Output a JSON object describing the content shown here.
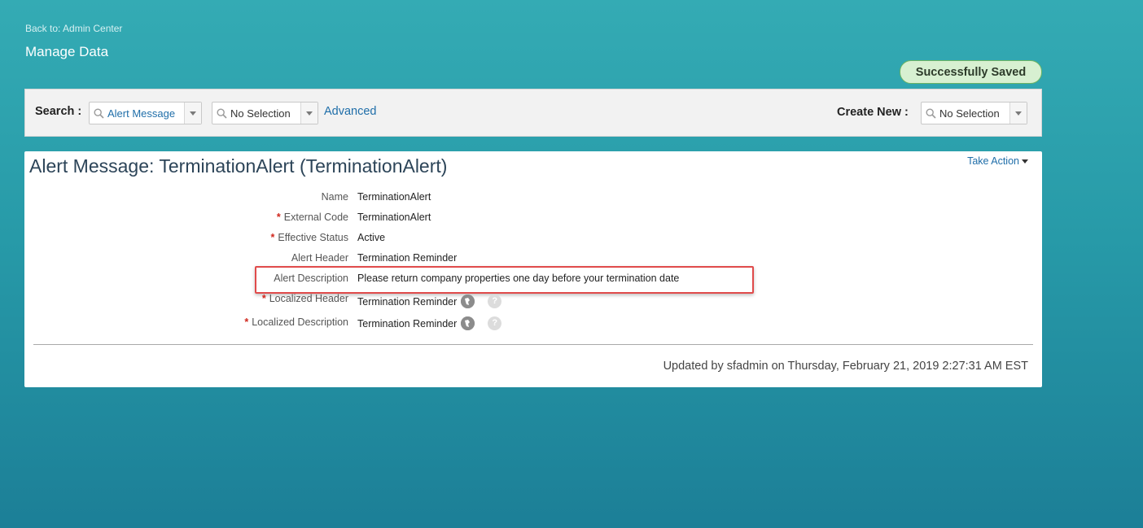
{
  "nav": {
    "back_link": "Back to: Admin Center",
    "page_title": "Manage Data"
  },
  "status": {
    "saved_badge": "Successfully Saved",
    "saved_color": "#d7f0d1"
  },
  "search_bar": {
    "search_label": "Search :",
    "search_type_value": "Alert Message",
    "search_item_value": "No Selection",
    "advanced_link": "Advanced",
    "create_label": "Create New :",
    "create_value": "No Selection"
  },
  "record": {
    "title": "Alert Message: TerminationAlert (TerminationAlert)",
    "take_action": "Take Action",
    "fields": [
      {
        "label": "Name",
        "required": "",
        "value": "TerminationAlert"
      },
      {
        "label": "External Code",
        "required": "*",
        "value": "TerminationAlert"
      },
      {
        "label": "Effective Status",
        "required": "*",
        "value": "Active"
      },
      {
        "label": "Alert Header",
        "required": "",
        "value": "Termination Reminder"
      },
      {
        "label": "Alert Description",
        "required": "",
        "value": "Please return company properties one day before your termination date"
      },
      {
        "label": "Localized Header",
        "required": "*",
        "value": "Termination Reminder"
      },
      {
        "label": "Localized Description",
        "required": "*",
        "value": "Termination Reminder"
      }
    ],
    "help_glyph": "?",
    "updated_text": "Updated by sfadmin on Thursday, February 21, 2019 2:27:31 AM EST"
  },
  "icons": {
    "search": "magnifier-icon",
    "dropdown": "chevron-down-icon",
    "translate": "globe-icon",
    "help": "help-icon"
  },
  "colors": {
    "accent_link": "#1f6ea9",
    "required_star": "#d0271d",
    "highlight_border": "#e04b4b"
  }
}
